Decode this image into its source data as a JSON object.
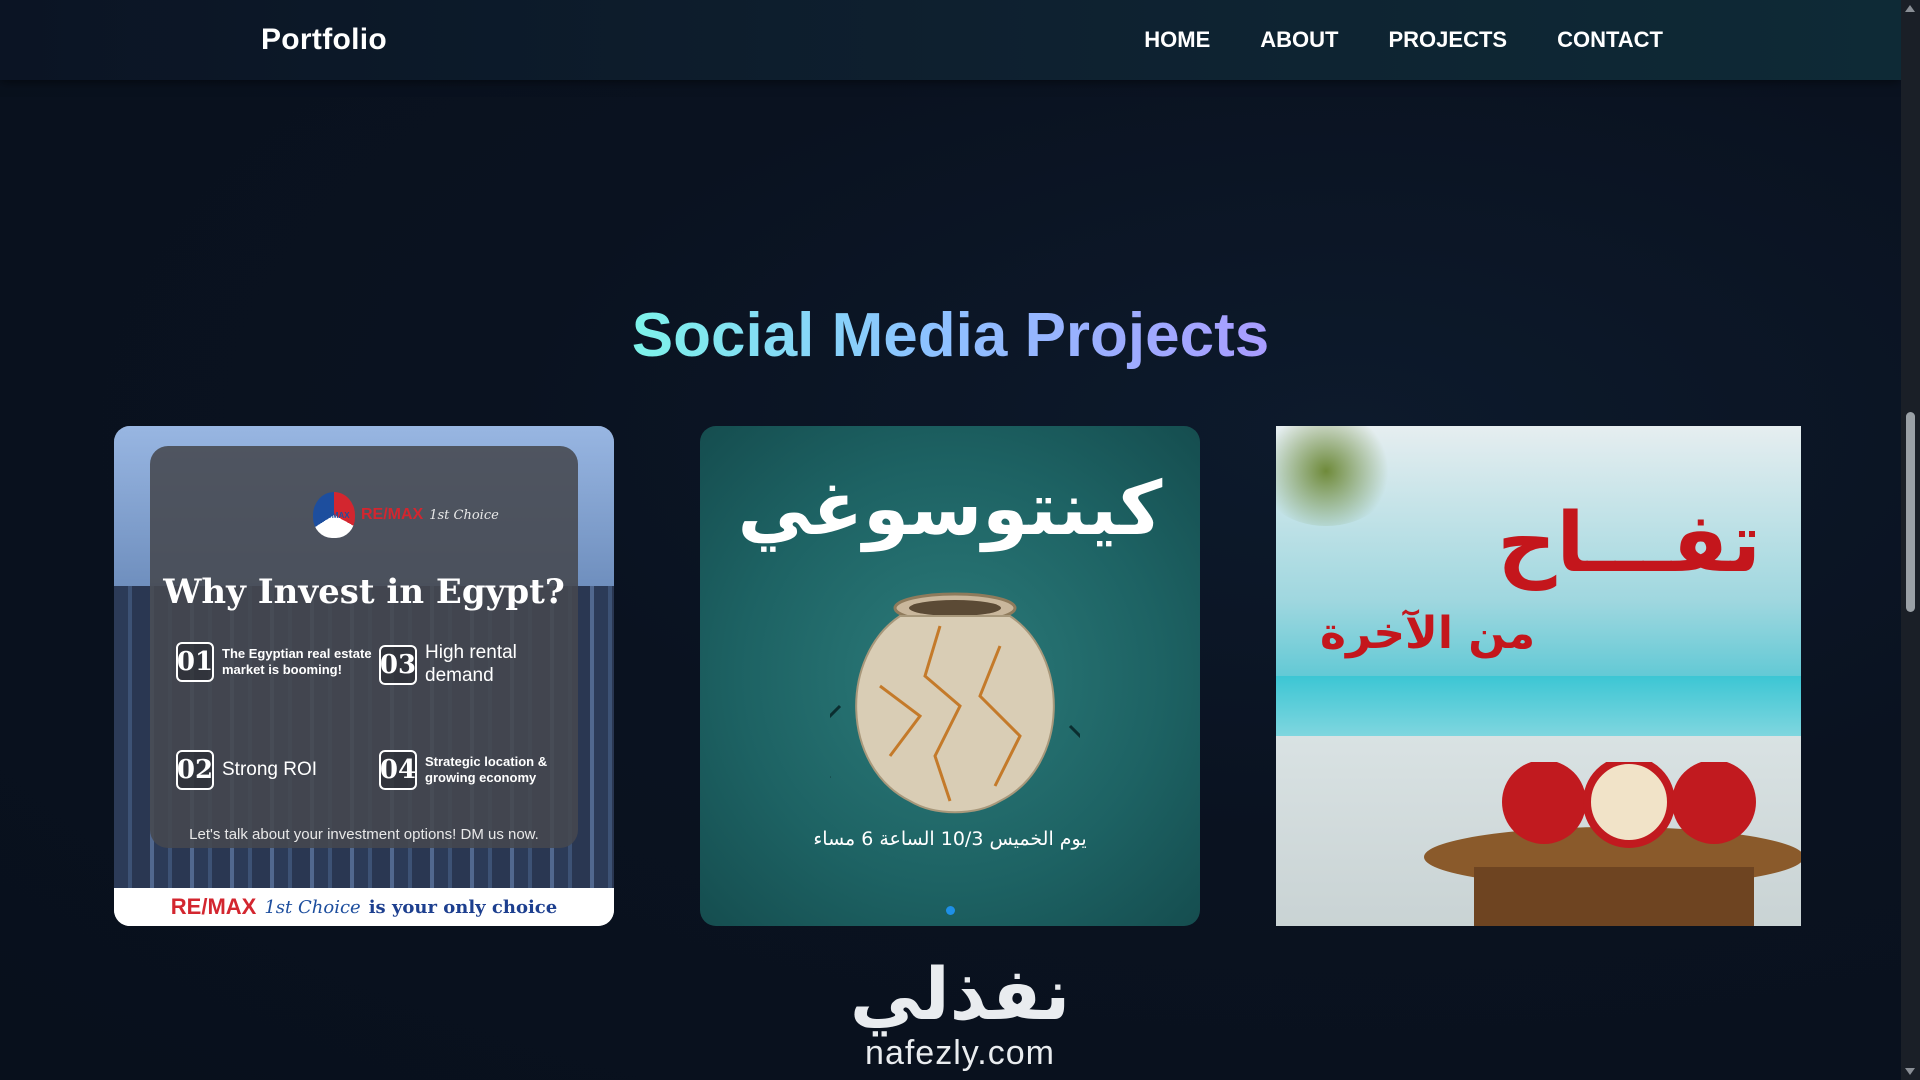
{
  "nav": {
    "brand": "Portfolio",
    "links": [
      "HOME",
      "ABOUT",
      "PROJECTS",
      "CONTACT"
    ]
  },
  "section": {
    "title": "Social Media Projects"
  },
  "card1": {
    "logo_balloon": "RE/MAX",
    "logo_brand": "RE/MAX",
    "logo_choice": "1st Choice",
    "heading": "Why Invest in Egypt?",
    "items": [
      {
        "num": "01",
        "text": "The Egyptian real estate market is booming!"
      },
      {
        "num": "03",
        "text": "High rental demand"
      },
      {
        "num": "02",
        "text": "Strong ROI"
      },
      {
        "num": "04",
        "text": "Strategic location & growing economy"
      }
    ],
    "cta": "Let's talk about your investment options! DM us now.",
    "footer_brand": "RE/MAX",
    "footer_choice": "1st Choice",
    "footer_text": "is your only choice"
  },
  "card2": {
    "title": "كينتوسوغي",
    "date": "يوم الخميس 10/3 الساعة 6 مساء",
    "carousel_active_index": 0
  },
  "card3": {
    "title": "تفـــاح",
    "subtitle": "من الآخرة"
  },
  "footer": {
    "logo_arabic": "نفذلي",
    "logo_latin": "nafezly.com"
  },
  "colors": {
    "title_gradient": [
      "#7df3ea",
      "#8cc3ff",
      "#a99cff"
    ],
    "remax_red": "#d3262f",
    "remax_blue": "#1d4e9e",
    "apple_red": "#c4161c",
    "carousel_active": "#1e8fe6"
  }
}
